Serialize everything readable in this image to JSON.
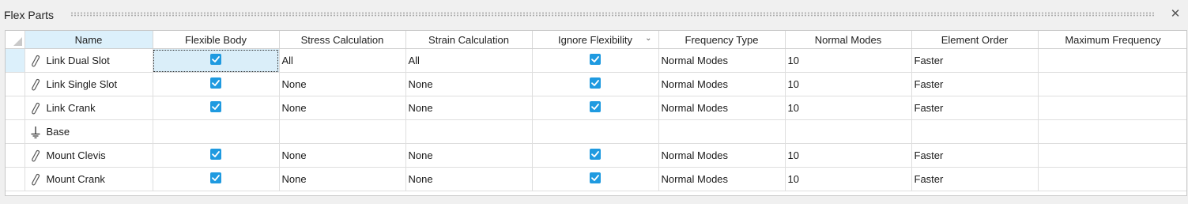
{
  "panel": {
    "title": "Flex Parts",
    "close_symbol": "✕"
  },
  "columns": {
    "name": "Name",
    "flexible_body": "Flexible Body",
    "stress": "Stress Calculation",
    "strain": "Strain Calculation",
    "ignore": "Ignore Flexibility",
    "freq_type": "Frequency Type",
    "normal_modes": "Normal Modes",
    "element_order": "Element Order",
    "max_freq": "Maximum Frequency"
  },
  "rows": [
    {
      "name": "Link Dual Slot",
      "icon": "flexible-part-icon",
      "flexible": true,
      "stress": "All",
      "strain": "All",
      "ignore": true,
      "freq_type": "Normal Modes",
      "modes": "10",
      "order": "Faster",
      "max_freq": ""
    },
    {
      "name": "Link Single Slot",
      "icon": "flexible-part-icon",
      "flexible": true,
      "stress": "None",
      "strain": "None",
      "ignore": true,
      "freq_type": "Normal Modes",
      "modes": "10",
      "order": "Faster",
      "max_freq": ""
    },
    {
      "name": "Link Crank",
      "icon": "flexible-part-icon",
      "flexible": true,
      "stress": "None",
      "strain": "None",
      "ignore": true,
      "freq_type": "Normal Modes",
      "modes": "10",
      "order": "Faster",
      "max_freq": ""
    },
    {
      "name": "Base",
      "icon": "ground-icon",
      "flexible": false,
      "stress": "",
      "strain": "",
      "ignore": false,
      "freq_type": "",
      "modes": "",
      "order": "",
      "max_freq": ""
    },
    {
      "name": "Mount Clevis",
      "icon": "flexible-part-icon",
      "flexible": true,
      "stress": "None",
      "strain": "None",
      "ignore": true,
      "freq_type": "Normal Modes",
      "modes": "10",
      "order": "Faster",
      "max_freq": ""
    },
    {
      "name": "Mount Crank",
      "icon": "flexible-part-icon",
      "flexible": true,
      "stress": "None",
      "strain": "None",
      "ignore": true,
      "freq_type": "Normal Modes",
      "modes": "10",
      "order": "Faster",
      "max_freq": ""
    }
  ],
  "colors": {
    "accent": "#1f9ae0",
    "selection": "#dcf0fb"
  }
}
